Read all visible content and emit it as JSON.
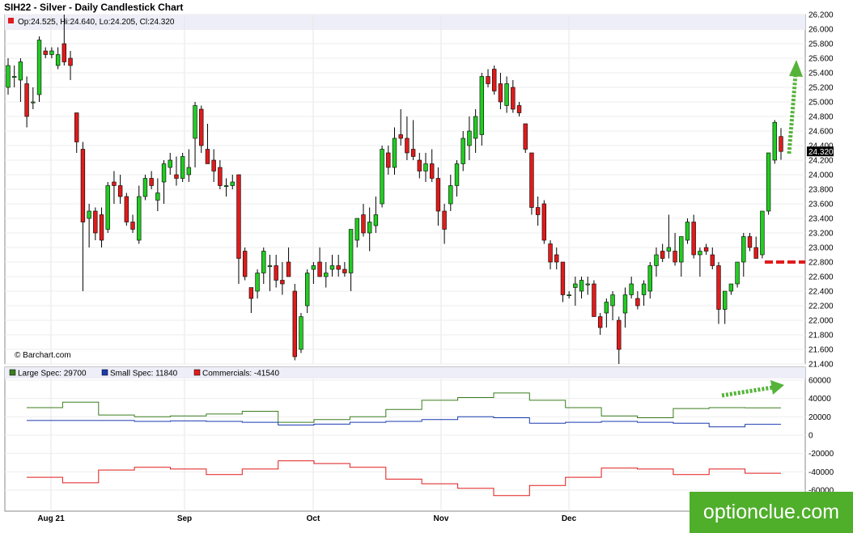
{
  "title": "SIH22 - Silver - Daily Candlestick Chart",
  "ohlc_label": "Op:24.525, Hi:24.640, Lo:24.205, Cl:24.320",
  "credit": "© Barchart.com",
  "last_price_label": "24.320",
  "watermark": "optionclue.com",
  "colors": {
    "up": "#22cc22",
    "down": "#e01b1b",
    "large_spec": "#3a7d1e",
    "small_spec": "#1a3ab0",
    "commercials": "#e01b1b",
    "arrow": "#55b33a",
    "level_line": "#e01b1b",
    "watermark_bg": "#4fae2a"
  },
  "chart_data": [
    {
      "type": "candlestick",
      "title": "SIH22 - Silver - Daily Candlestick Chart",
      "ylim": [
        21.4,
        26.2
      ],
      "y_ticks": [
        "26.200",
        "26.000",
        "25.800",
        "25.600",
        "25.400",
        "25.200",
        "25.000",
        "24.800",
        "24.600",
        "24.400",
        "24.200",
        "24.000",
        "23.800",
        "23.600",
        "23.400",
        "23.200",
        "23.000",
        "22.800",
        "22.600",
        "22.400",
        "22.200",
        "22.000",
        "21.800",
        "21.600",
        "21.400"
      ],
      "x_ticks": [
        "Aug 21",
        "Sep",
        "Oct",
        "Nov",
        "Dec"
      ],
      "last_close": 24.32,
      "support_level": 22.8,
      "ohlc": [
        [
          25.2,
          25.6,
          25.1,
          25.5
        ],
        [
          25.35,
          25.5,
          25.2,
          25.35
        ],
        [
          25.3,
          25.6,
          25.0,
          25.55
        ],
        [
          25.25,
          25.35,
          24.65,
          24.8
        ],
        [
          25.0,
          25.2,
          24.9,
          25.0
        ],
        [
          25.1,
          25.9,
          25.0,
          25.85
        ],
        [
          25.7,
          25.75,
          25.6,
          25.65
        ],
        [
          25.65,
          25.75,
          25.6,
          25.7
        ],
        [
          25.5,
          25.75,
          25.45,
          25.65
        ],
        [
          25.8,
          26.2,
          25.5,
          25.55
        ],
        [
          25.6,
          25.7,
          25.3,
          25.5
        ],
        [
          24.85,
          24.85,
          24.3,
          24.45
        ],
        [
          24.35,
          24.45,
          22.4,
          23.35
        ],
        [
          23.4,
          23.6,
          23.0,
          23.5
        ],
        [
          23.5,
          23.55,
          23.1,
          23.2
        ],
        [
          23.45,
          23.55,
          23.0,
          23.1
        ],
        [
          23.25,
          23.9,
          23.2,
          23.85
        ],
        [
          23.9,
          24.05,
          23.6,
          23.85
        ],
        [
          23.85,
          24.0,
          23.6,
          23.7
        ],
        [
          23.7,
          23.75,
          23.3,
          23.35
        ],
        [
          23.35,
          23.45,
          23.2,
          23.25
        ],
        [
          23.1,
          23.85,
          23.05,
          23.7
        ],
        [
          23.7,
          24.0,
          23.65,
          23.95
        ],
        [
          23.95,
          24.05,
          23.8,
          23.85
        ],
        [
          23.65,
          23.95,
          23.5,
          23.75
        ],
        [
          23.9,
          24.2,
          23.6,
          24.15
        ],
        [
          24.1,
          24.3,
          24.0,
          24.2
        ],
        [
          24.0,
          24.25,
          23.85,
          23.95
        ],
        [
          23.95,
          24.3,
          23.9,
          24.25
        ],
        [
          24.0,
          24.35,
          23.9,
          24.1
        ],
        [
          24.5,
          25.0,
          24.1,
          24.95
        ],
        [
          24.9,
          24.95,
          24.3,
          24.4
        ],
        [
          24.35,
          24.7,
          24.2,
          24.15
        ],
        [
          24.2,
          24.35,
          23.9,
          24.05
        ],
        [
          24.1,
          24.2,
          23.8,
          23.85
        ],
        [
          23.85,
          23.95,
          23.7,
          23.85
        ],
        [
          23.85,
          24.0,
          23.8,
          23.9
        ],
        [
          24.0,
          24.0,
          22.5,
          22.85
        ],
        [
          22.95,
          23.0,
          22.55,
          22.6
        ],
        [
          22.45,
          22.45,
          22.1,
          22.3
        ],
        [
          22.4,
          22.7,
          22.3,
          22.65
        ],
        [
          22.65,
          23.0,
          22.5,
          22.95
        ],
        [
          22.75,
          22.9,
          22.4,
          22.75
        ],
        [
          22.75,
          22.9,
          22.45,
          22.55
        ],
        [
          22.55,
          22.8,
          22.35,
          22.5
        ],
        [
          22.8,
          23.0,
          22.6,
          22.6
        ],
        [
          22.4,
          22.5,
          21.45,
          21.5
        ],
        [
          21.6,
          22.1,
          21.55,
          22.05
        ],
        [
          22.2,
          22.7,
          22.1,
          22.65
        ],
        [
          22.7,
          22.8,
          22.5,
          22.75
        ],
        [
          22.8,
          23.0,
          22.6,
          22.6
        ],
        [
          22.6,
          22.8,
          22.45,
          22.65
        ],
        [
          22.7,
          22.9,
          22.6,
          22.75
        ],
        [
          22.75,
          22.9,
          22.6,
          22.7
        ],
        [
          22.7,
          22.8,
          22.6,
          22.65
        ],
        [
          22.65,
          23.2,
          22.4,
          23.25
        ],
        [
          23.1,
          23.4,
          23.0,
          23.4
        ],
        [
          23.45,
          23.6,
          23.15,
          23.2
        ],
        [
          23.2,
          23.55,
          22.95,
          23.35
        ],
        [
          23.3,
          23.7,
          23.2,
          23.45
        ],
        [
          23.6,
          24.4,
          23.55,
          24.35
        ],
        [
          24.3,
          24.4,
          24.0,
          24.1
        ],
        [
          24.1,
          24.65,
          24.0,
          24.5
        ],
        [
          24.55,
          24.9,
          24.4,
          24.5
        ],
        [
          24.5,
          24.8,
          24.2,
          24.3
        ],
        [
          24.35,
          24.75,
          24.2,
          24.25
        ],
        [
          24.2,
          24.3,
          23.95,
          24.05
        ],
        [
          24.05,
          24.3,
          23.9,
          24.15
        ],
        [
          24.15,
          24.35,
          23.9,
          23.95
        ],
        [
          23.95,
          24.1,
          23.3,
          23.5
        ],
        [
          23.5,
          23.6,
          23.05,
          23.25
        ],
        [
          23.6,
          24.0,
          23.5,
          23.85
        ],
        [
          23.85,
          24.2,
          23.7,
          24.15
        ],
        [
          24.15,
          24.6,
          24.05,
          24.5
        ],
        [
          24.4,
          24.8,
          24.2,
          24.6
        ],
        [
          24.5,
          24.9,
          24.3,
          24.8
        ],
        [
          24.55,
          25.4,
          24.4,
          25.35
        ],
        [
          25.35,
          25.45,
          25.2,
          25.25
        ],
        [
          25.45,
          25.5,
          25.1,
          25.15
        ],
        [
          25.25,
          25.4,
          24.9,
          25.0
        ],
        [
          24.95,
          25.35,
          24.85,
          25.25
        ],
        [
          25.2,
          25.3,
          24.85,
          24.9
        ],
        [
          24.95,
          25.0,
          24.8,
          24.85
        ],
        [
          24.7,
          24.7,
          24.3,
          24.35
        ],
        [
          24.3,
          24.3,
          23.45,
          23.55
        ],
        [
          23.55,
          23.7,
          23.3,
          23.45
        ],
        [
          23.6,
          23.65,
          23.05,
          23.1
        ],
        [
          23.05,
          23.1,
          22.7,
          22.8
        ],
        [
          22.9,
          23.0,
          22.7,
          22.8
        ],
        [
          22.8,
          22.8,
          22.25,
          22.35
        ],
        [
          22.35,
          22.4,
          22.3,
          22.35
        ],
        [
          22.45,
          22.6,
          22.2,
          22.5
        ],
        [
          22.4,
          22.6,
          22.3,
          22.55
        ],
        [
          22.5,
          22.6,
          22.35,
          22.5
        ],
        [
          22.5,
          22.55,
          22.1,
          22.05
        ],
        [
          22.05,
          22.1,
          21.8,
          21.9
        ],
        [
          22.1,
          22.3,
          21.9,
          22.25
        ],
        [
          22.2,
          22.4,
          22.0,
          22.35
        ],
        [
          22.0,
          22.05,
          21.4,
          21.6
        ],
        [
          22.1,
          22.45,
          21.9,
          22.35
        ],
        [
          22.35,
          22.6,
          22.3,
          22.5
        ],
        [
          22.3,
          22.4,
          22.15,
          22.2
        ],
        [
          22.35,
          22.55,
          22.2,
          22.5
        ],
        [
          22.4,
          22.8,
          22.3,
          22.75
        ],
        [
          22.75,
          23.0,
          22.6,
          22.9
        ],
        [
          22.95,
          23.05,
          22.8,
          22.85
        ],
        [
          22.95,
          23.45,
          22.85,
          23.0
        ],
        [
          22.95,
          23.2,
          22.75,
          22.8
        ],
        [
          22.8,
          23.1,
          22.6,
          23.15
        ],
        [
          23.1,
          23.4,
          23.05,
          23.35
        ],
        [
          23.35,
          23.45,
          22.85,
          22.9
        ],
        [
          22.9,
          23.0,
          22.6,
          22.95
        ],
        [
          23.0,
          23.05,
          22.9,
          22.95
        ],
        [
          22.9,
          23.0,
          22.7,
          22.75
        ],
        [
          22.75,
          22.8,
          21.95,
          22.15
        ],
        [
          22.15,
          22.4,
          21.95,
          22.4
        ],
        [
          22.4,
          22.5,
          22.35,
          22.5
        ],
        [
          22.5,
          22.8,
          22.45,
          22.8
        ],
        [
          22.8,
          23.2,
          22.6,
          23.15
        ],
        [
          23.15,
          23.2,
          22.95,
          23.0
        ],
        [
          23.0,
          23.15,
          22.85,
          22.85
        ],
        [
          22.9,
          23.5,
          22.85,
          23.5
        ],
        [
          23.5,
          24.3,
          23.45,
          24.3
        ],
        [
          24.2,
          24.75,
          24.15,
          24.72
        ],
        [
          24.525,
          24.64,
          24.205,
          24.32
        ]
      ]
    },
    {
      "type": "line",
      "ylim": [
        -60000,
        60000
      ],
      "y_ticks": [
        "60000",
        "40000",
        "20000",
        "0",
        "-20000",
        "-40000",
        "-60000"
      ],
      "series": [
        {
          "name": "Large Spec: 29700",
          "values": [
            30000,
            36000,
            22000,
            20000,
            21000,
            23000,
            26000,
            14000,
            17000,
            20000,
            28000,
            38000,
            41000,
            46000,
            38000,
            30000,
            21000,
            19000,
            29000,
            30000,
            29700
          ]
        },
        {
          "name": "Small Spec: 11840",
          "values": [
            16000,
            16000,
            16000,
            15000,
            15500,
            15000,
            14000,
            11000,
            12000,
            14000,
            15000,
            17000,
            20000,
            19000,
            13000,
            14000,
            15000,
            14000,
            13000,
            9000,
            11840
          ]
        },
        {
          "name": "Commercials: -41540",
          "values": [
            -46000,
            -52000,
            -38000,
            -35000,
            -37000,
            -43000,
            -37000,
            -28000,
            -31000,
            -35000,
            -48000,
            -53000,
            -58000,
            -66000,
            -55000,
            -46000,
            -36000,
            -37000,
            -43000,
            -37000,
            -41540
          ]
        }
      ]
    }
  ]
}
